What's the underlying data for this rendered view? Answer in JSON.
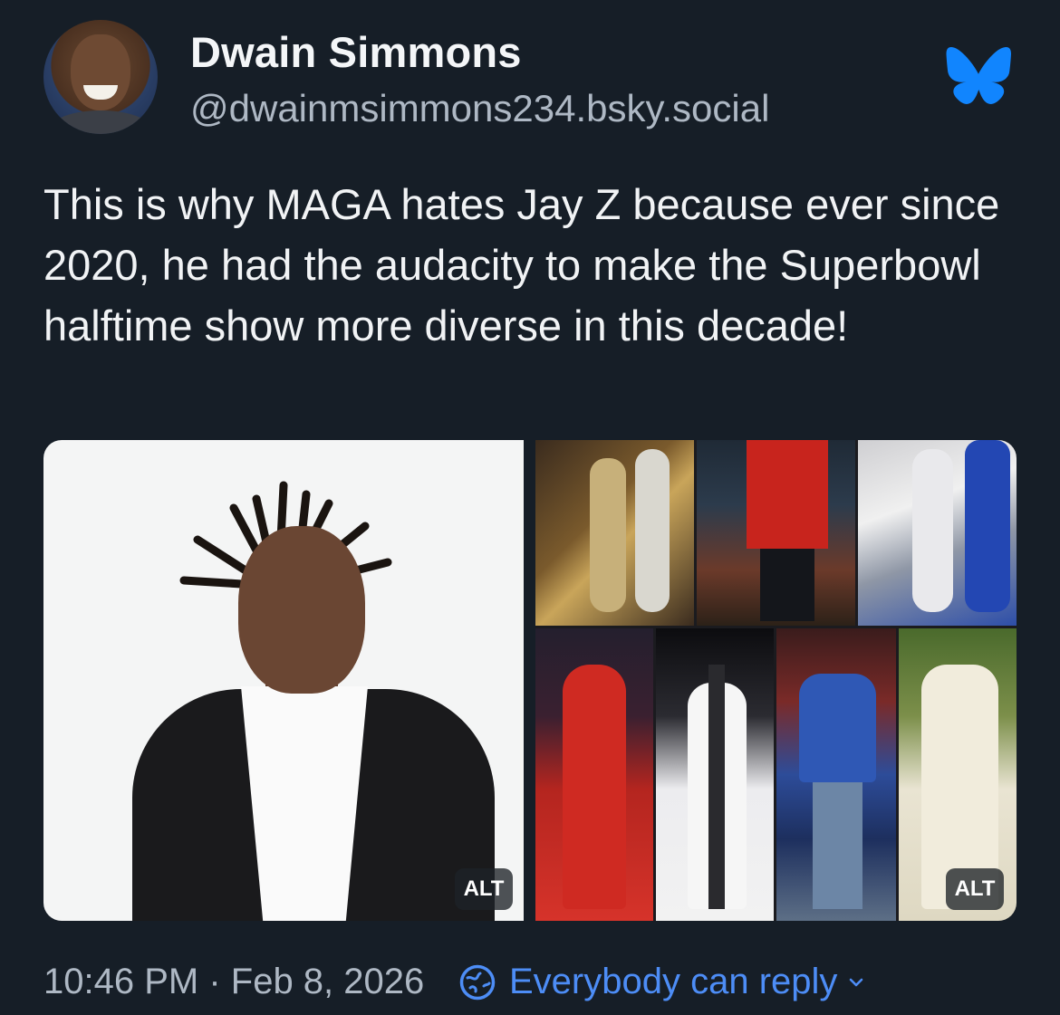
{
  "author": {
    "display_name": "Dwain Simmons",
    "handle": "@dwainmsimmons234.bsky.social"
  },
  "platform_icon": "bluesky-butterfly-icon",
  "post": {
    "text": "This is why MAGA hates Jay Z because ever since 2020, he had the audacity to make the Superbowl halftime show more diverse in this decade!"
  },
  "media": {
    "left_image": {
      "alt_badge": "ALT"
    },
    "right_image": {
      "alt_badge": "ALT"
    }
  },
  "footer": {
    "timestamp": "10:46 PM · Feb 8, 2026",
    "reply_setting": "Everybody can reply",
    "reply_icon": "globe-icon",
    "chevron_icon": "chevron-down-icon"
  },
  "colors": {
    "background": "#161e27",
    "accent": "#4d8df6",
    "bluesky_blue": "#1185fe",
    "secondary_text": "#aeb8c4"
  }
}
